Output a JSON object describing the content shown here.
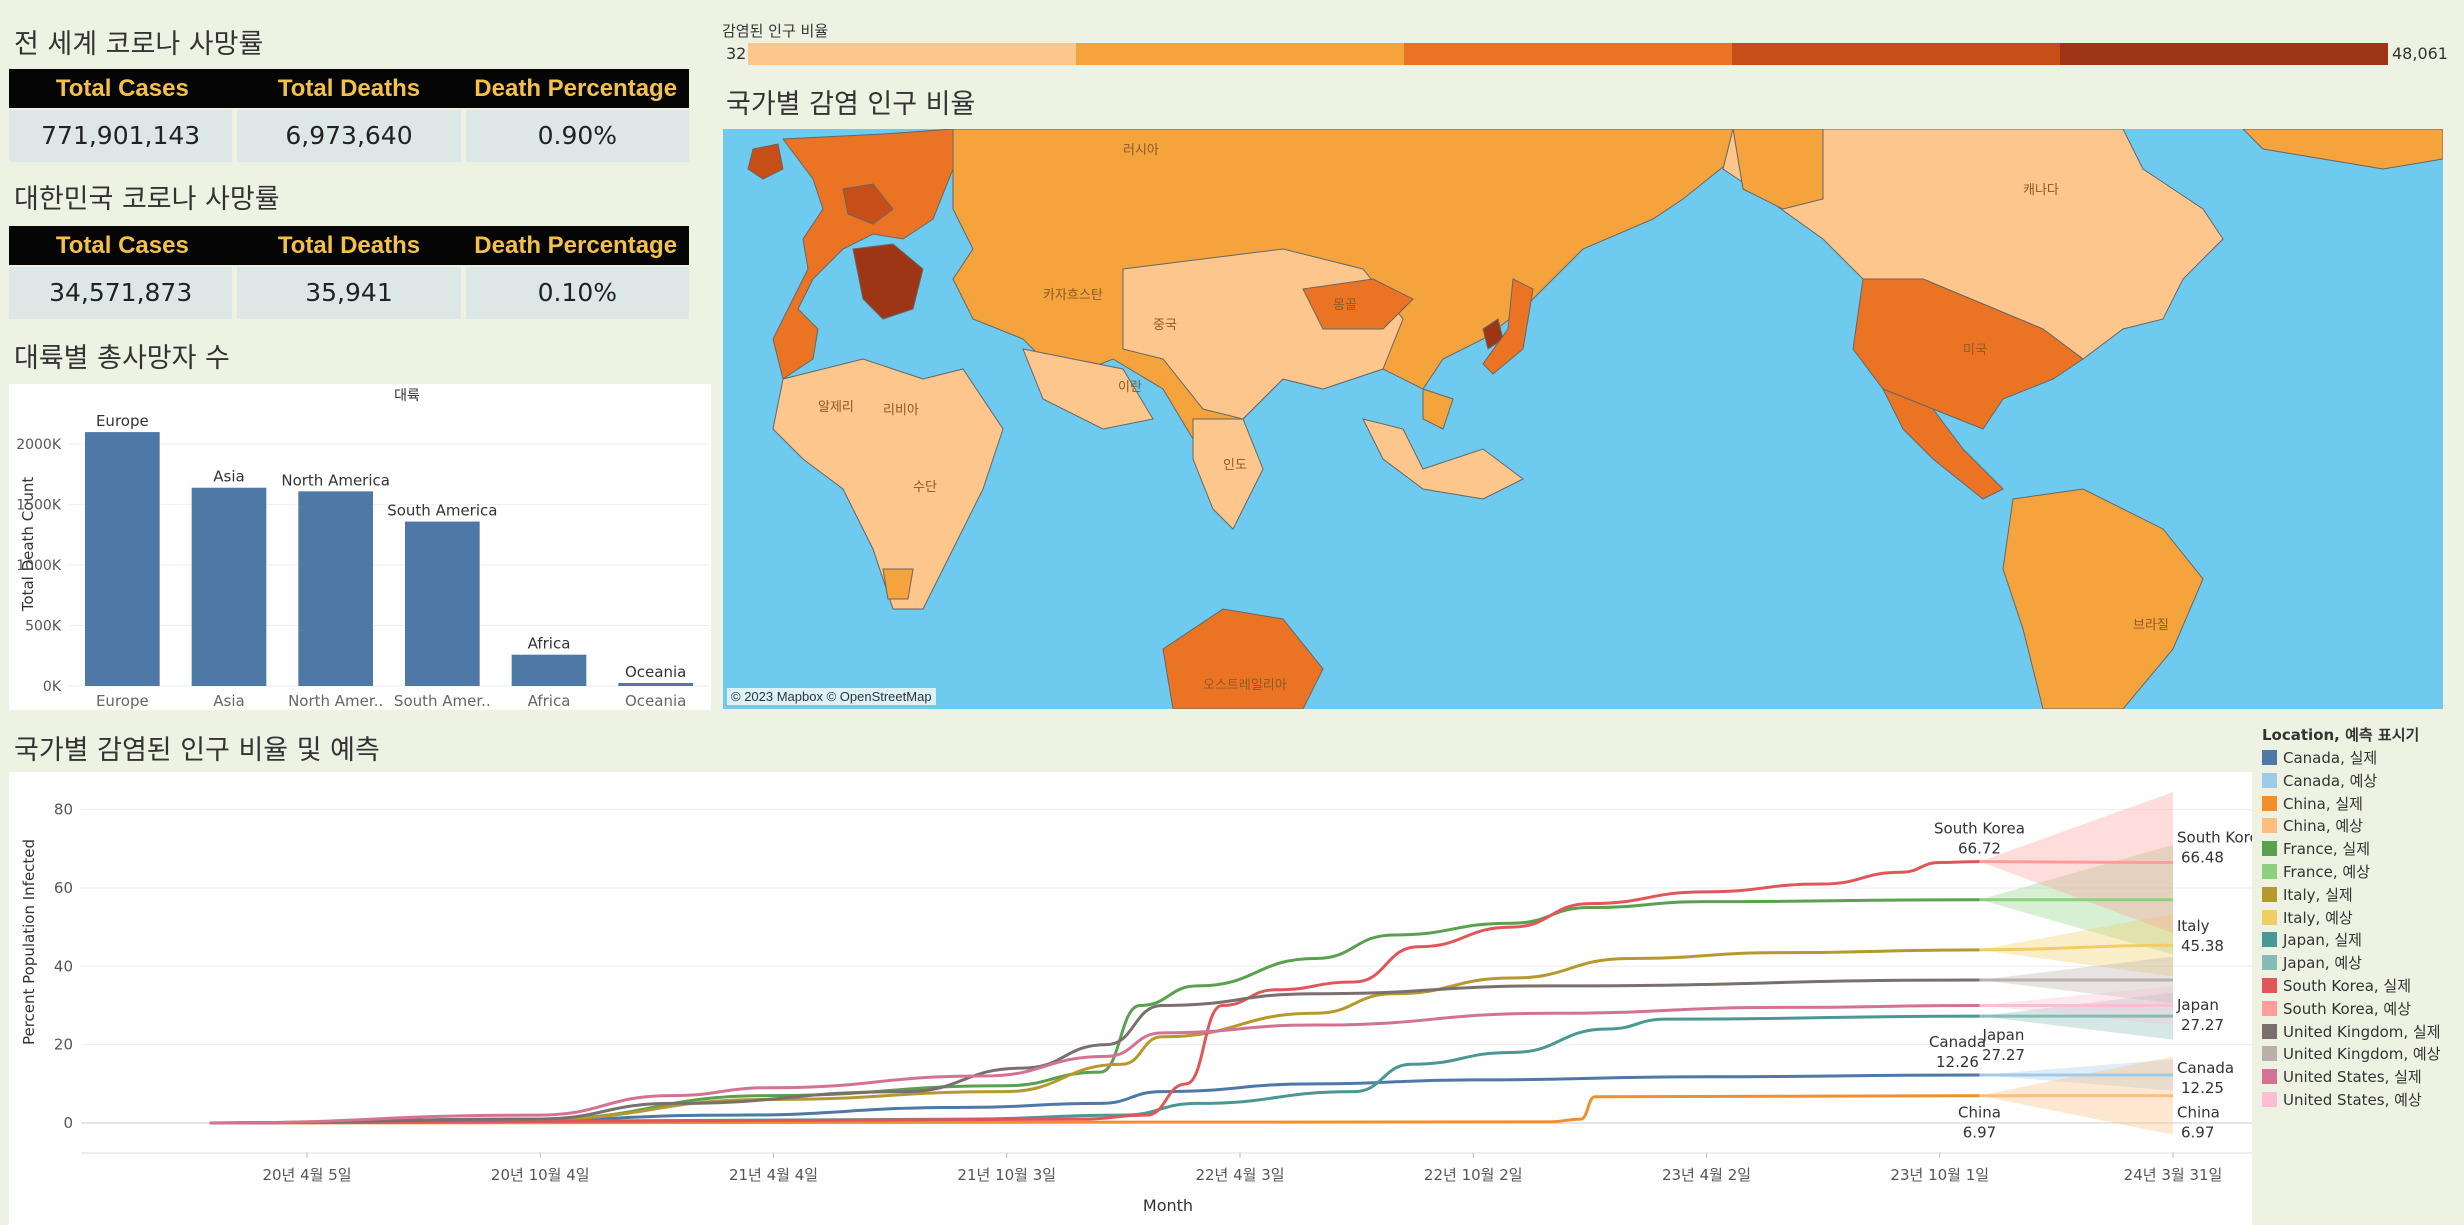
{
  "colors": {
    "background": "#eef2e3",
    "header_bg": "#050505",
    "header_text": "#f3c04b",
    "cell_bg": "#dde8e6",
    "bar": "#4e79a7",
    "ocean": "#6fcaef",
    "scale": [
      "#fdc68d",
      "#f4a33d",
      "#eb7424",
      "#c84e18",
      "#9e3514"
    ]
  },
  "world_table": {
    "title": "전 세계 코로나 사망률",
    "headers": [
      "Total Cases",
      "Total Deaths",
      "Death Percentage"
    ],
    "values": [
      "771,901,143",
      "6,973,640",
      "0.90%"
    ]
  },
  "korea_table": {
    "title": "대한민국 코로나 사망률",
    "headers": [
      "Total Cases",
      "Total Deaths",
      "Death Percentage"
    ],
    "values": [
      "34,571,873",
      "35,941",
      "0.10%"
    ]
  },
  "color_legend": {
    "title": "감염된 인구 비율",
    "min": "32",
    "max": "48,061"
  },
  "map": {
    "title": "국가별 감염 인구 비율",
    "attribution": "© 2023 Mapbox © OpenStreetMap",
    "labels": [
      "러시아",
      "캐나다",
      "미국",
      "중국",
      "몽골",
      "카자흐스탄",
      "알제리",
      "리비아",
      "인도",
      "브라질",
      "오스트레일리아",
      "이란",
      "수단"
    ]
  },
  "bar_section_title": "대륙별 총사망자 수",
  "line_section_title": "국가별 감염된 인구 비율 및 예측",
  "chart_data": [
    {
      "type": "bar",
      "title": "대륙",
      "ylabel": "Total Death Count",
      "categories": [
        "Europe",
        "Asia",
        "North America",
        "South America",
        "Africa",
        "Oceania"
      ],
      "tick_labels": [
        "Europe",
        "Asia",
        "North Amer..",
        "South Amer..",
        "Africa",
        "Oceania"
      ],
      "values": [
        2100000,
        1640000,
        1610000,
        1360000,
        259000,
        25000
      ],
      "yticks": [
        "0K",
        "500K",
        "1000K",
        "1500K",
        "2000K"
      ],
      "ylim": [
        0,
        2200000
      ]
    },
    {
      "type": "line",
      "xlabel": "Month",
      "ylabel": "Percent Population Infected",
      "ylim": [
        0,
        85
      ],
      "yticks": [
        "0",
        "20",
        "40",
        "60",
        "80"
      ],
      "xticks": [
        "20년 4월 5일",
        "20년 10월 4일",
        "21년 4월 4일",
        "21년 10월 3일",
        "22년 4월 3일",
        "22년 10월 2일",
        "23년 4월 2일",
        "23년 10월 1일",
        "24년 3월 31일"
      ],
      "xtick_dates": [
        "2020-04-05",
        "2020-10-04",
        "2021-04-04",
        "2021-10-03",
        "2022-04-03",
        "2022-10-02",
        "2023-04-02",
        "2023-10-01",
        "2024-03-31"
      ],
      "forecast_start": "2023-11-01",
      "forecast_end": "2024-03-31",
      "legend_title": "Location, 예측 표시기",
      "legend_entries": [
        "Canada, 실제",
        "Canada, 예상",
        "China, 실제",
        "China, 예상",
        "France, 실제",
        "France, 예상",
        "Italy, 실제",
        "Italy, 예상",
        "Japan, 실제",
        "Japan, 예상",
        "South Korea, 실제",
        "South Korea, 예상",
        "United Kingdom, 실제",
        "United Kingdom, 예상",
        "United States, 실제",
        "United States, 예상"
      ],
      "series": [
        {
          "name": "Canada",
          "color": "#4e79a7",
          "forecast_color": "#a0cbe8",
          "band": 4,
          "points": [
            [
              "2020-01-20",
              0
            ],
            [
              "2020-09-01",
              0.4
            ],
            [
              "2021-03-01",
              2
            ],
            [
              "2021-09-01",
              4
            ],
            [
              "2021-12-15",
              5
            ],
            [
              "2022-02-01",
              8
            ],
            [
              "2022-06-01",
              10
            ],
            [
              "2022-10-01",
              11
            ],
            [
              "2023-04-01",
              11.8
            ],
            [
              "2023-11-01",
              12.26
            ],
            [
              "2024-03-31",
              12.25
            ]
          ],
          "labels": [
            {
              "date": "2023-11-01",
              "text": "Canada",
              "value": "12.26"
            },
            {
              "date": "2024-03-31",
              "text": "Canada",
              "value": "12.25"
            }
          ]
        },
        {
          "name": "China",
          "color": "#f28e2b",
          "forecast_color": "#ffbe7d",
          "band": 10,
          "points": [
            [
              "2020-01-20",
              0
            ],
            [
              "2022-12-01",
              0.3
            ],
            [
              "2022-12-25",
              1
            ],
            [
              "2023-01-05",
              6.7
            ],
            [
              "2023-11-01",
              6.97
            ],
            [
              "2024-03-31",
              6.97
            ]
          ],
          "labels": [
            {
              "date": "2023-11-01",
              "text": "China",
              "value": "6.97"
            },
            {
              "date": "2024-03-31",
              "text": "China",
              "value": "6.97"
            }
          ]
        },
        {
          "name": "France",
          "color": "#59a14f",
          "forecast_color": "#8cd17d",
          "band": 14,
          "points": [
            [
              "2020-01-20",
              0
            ],
            [
              "2020-10-01",
              1
            ],
            [
              "2021-04-01",
              7
            ],
            [
              "2021-10-01",
              9.5
            ],
            [
              "2021-12-15",
              13
            ],
            [
              "2022-01-15",
              30
            ],
            [
              "2022-03-01",
              35
            ],
            [
              "2022-06-01",
              42
            ],
            [
              "2022-08-01",
              48
            ],
            [
              "2022-11-01",
              51
            ],
            [
              "2023-01-01",
              55
            ],
            [
              "2023-04-01",
              56.5
            ],
            [
              "2023-11-01",
              57
            ],
            [
              "2024-03-31",
              57
            ]
          ],
          "labels": []
        },
        {
          "name": "Italy",
          "color": "#b6992d",
          "forecast_color": "#f1ce63",
          "band": 8,
          "points": [
            [
              "2020-01-20",
              0
            ],
            [
              "2020-10-01",
              1
            ],
            [
              "2021-04-01",
              6
            ],
            [
              "2021-10-01",
              8
            ],
            [
              "2022-01-01",
              15
            ],
            [
              "2022-02-01",
              22
            ],
            [
              "2022-06-01",
              28
            ],
            [
              "2022-08-01",
              33
            ],
            [
              "2022-11-01",
              37
            ],
            [
              "2023-02-01",
              42
            ],
            [
              "2023-06-01",
              43.5
            ],
            [
              "2023-11-01",
              44.2
            ],
            [
              "2024-03-31",
              45.38
            ]
          ],
          "labels": [
            {
              "date": "2024-03-31",
              "text": "Italy",
              "value": "45.38"
            }
          ]
        },
        {
          "name": "Japan",
          "color": "#499894",
          "forecast_color": "#86bcb6",
          "band": 6,
          "points": [
            [
              "2020-01-20",
              0
            ],
            [
              "2021-09-01",
              1
            ],
            [
              "2022-01-01",
              2
            ],
            [
              "2022-03-01",
              5
            ],
            [
              "2022-07-01",
              8
            ],
            [
              "2022-08-15",
              15
            ],
            [
              "2022-11-01",
              18
            ],
            [
              "2023-01-15",
              24
            ],
            [
              "2023-03-01",
              26.5
            ],
            [
              "2023-11-01",
              27.27
            ],
            [
              "2024-03-31",
              27.27
            ]
          ],
          "labels": [
            {
              "date": "2023-11-01",
              "text": "Japan",
              "value": "27.27"
            },
            {
              "date": "2024-03-31",
              "text": "Japan",
              "value": "27.27"
            }
          ]
        },
        {
          "name": "South Korea",
          "color": "#e15759",
          "forecast_color": "#ff9d9a",
          "band": 18,
          "points": [
            [
              "2020-01-20",
              0
            ],
            [
              "2021-12-01",
              1
            ],
            [
              "2022-01-20",
              2
            ],
            [
              "2022-02-20",
              10
            ],
            [
              "2022-03-20",
              30
            ],
            [
              "2022-05-01",
              34
            ],
            [
              "2022-07-01",
              36
            ],
            [
              "2022-08-20",
              45
            ],
            [
              "2022-11-01",
              50
            ],
            [
              "2023-01-01",
              56
            ],
            [
              "2023-04-01",
              59
            ],
            [
              "2023-07-01",
              61
            ],
            [
              "2023-09-01",
              64
            ],
            [
              "2023-10-01",
              66.5
            ],
            [
              "2023-11-01",
              66.72
            ],
            [
              "2024-03-31",
              66.48
            ]
          ],
          "labels": [
            {
              "date": "2023-11-01",
              "text": "South Korea",
              "value": "66.72",
              "above": true
            },
            {
              "date": "2024-03-31",
              "text": "South Korea",
              "value": "66.48"
            }
          ]
        },
        {
          "name": "United Kingdom",
          "color": "#79706e",
          "forecast_color": "#bab0ac",
          "band": 6,
          "points": [
            [
              "2020-01-20",
              0
            ],
            [
              "2020-10-01",
              1
            ],
            [
              "2021-01-15",
              5
            ],
            [
              "2021-07-15",
              8
            ],
            [
              "2021-10-15",
              14
            ],
            [
              "2021-12-20",
              20
            ],
            [
              "2022-02-01",
              30
            ],
            [
              "2022-06-01",
              33
            ],
            [
              "2022-12-01",
              35
            ],
            [
              "2023-11-01",
              36.5
            ],
            [
              "2024-03-31",
              36.5
            ]
          ],
          "labels": []
        },
        {
          "name": "United States",
          "color": "#d37295",
          "forecast_color": "#fabfd2",
          "band": 5,
          "points": [
            [
              "2020-01-20",
              0
            ],
            [
              "2020-10-01",
              2
            ],
            [
              "2021-01-15",
              7
            ],
            [
              "2021-04-01",
              9
            ],
            [
              "2021-09-15",
              12
            ],
            [
              "2021-12-20",
              17
            ],
            [
              "2022-02-01",
              23
            ],
            [
              "2022-06-01",
              25
            ],
            [
              "2022-12-01",
              28
            ],
            [
              "2023-06-01",
              29.5
            ],
            [
              "2023-11-01",
              30
            ],
            [
              "2024-03-31",
              30
            ]
          ],
          "labels": []
        }
      ]
    }
  ]
}
